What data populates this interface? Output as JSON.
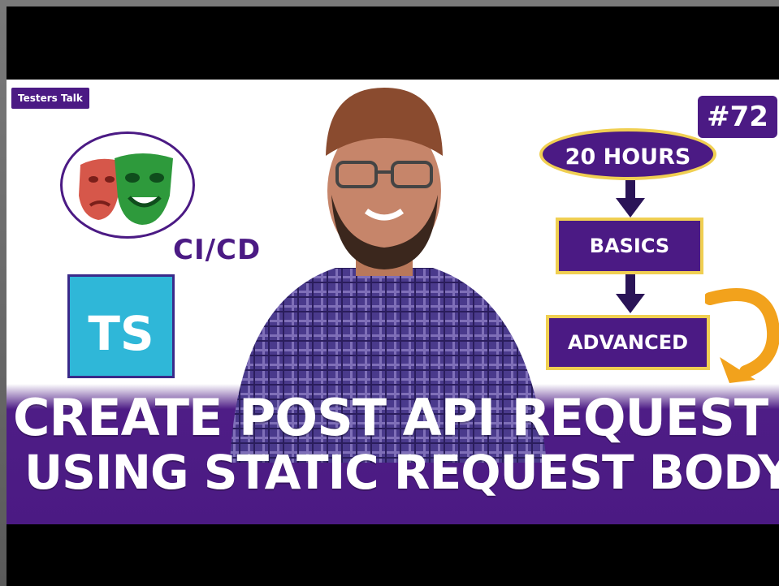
{
  "thumbnail": {
    "channel_name": "Testers Talk",
    "episode": "#72",
    "left_tags": {
      "cicd_label": "CI/CD",
      "ts_label": "TS"
    },
    "flow": {
      "hours": "20 HOURS",
      "basics": "BASICS",
      "advanced": "ADVANCED"
    },
    "title_line_1": "CREATE POST API REQUEST",
    "title_line_2": "USING STATIC REQUEST BODY"
  },
  "colors": {
    "brand_purple": "#4b1a84",
    "accent_gold": "#f0cf52",
    "ts_blue": "#2fb7d8",
    "arrow_orange": "#f2a21c"
  },
  "icons": [
    "playwright-masks-icon",
    "typescript-icon",
    "curved-arrow-icon",
    "down-arrow-icon"
  ]
}
